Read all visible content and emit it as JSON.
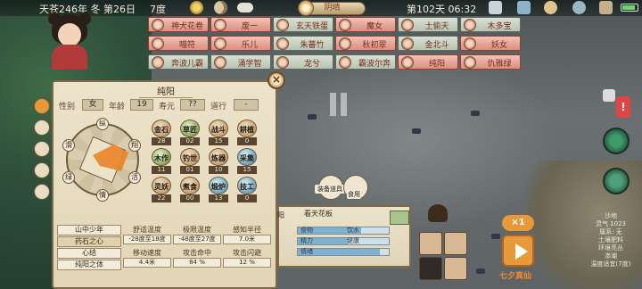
{
  "topbar": {
    "date": "天苍246年 冬 第26日",
    "temperature": "7度",
    "weather_badge": "阴晴",
    "day_time": "第102天 06:32"
  },
  "npcs": [
    {
      "name": "神犬花卷",
      "highlighted": true
    },
    {
      "name": "废一",
      "highlighted": true
    },
    {
      "name": "玄天铁蛋",
      "highlighted": false
    },
    {
      "name": "魔女",
      "highlighted": true
    },
    {
      "name": "土偷天",
      "highlighted": false
    },
    {
      "name": "木多宝",
      "highlighted": false
    },
    {
      "name": "喵符",
      "highlighted": true
    },
    {
      "name": "乐儿",
      "highlighted": true
    },
    {
      "name": "朱蕃竹",
      "highlighted": false
    },
    {
      "name": "秋初翠",
      "highlighted": true
    },
    {
      "name": "金北斗",
      "highlighted": false
    },
    {
      "name": "妖女",
      "highlighted": true
    },
    {
      "name": "奔波儿霸",
      "highlighted": false
    },
    {
      "name": "涌学智",
      "highlighted": false
    },
    {
      "name": "龙兮",
      "highlighted": false
    },
    {
      "name": "霸波尔奔",
      "highlighted": false
    },
    {
      "name": "纯阳",
      "highlighted": true
    },
    {
      "name": "仇雅绿",
      "highlighted": true
    }
  ],
  "character": {
    "name": "纯阳",
    "gender_label": "性别",
    "gender": "女",
    "age_label": "年龄",
    "age": "19",
    "lifespan_label": "寿元",
    "lifespan": "??",
    "dao_label": "道行",
    "dao": "-",
    "close_label": "×",
    "bagua_labels": [
      "纵",
      "翔",
      "活",
      "情",
      "绿",
      "滑"
    ],
    "skills": [
      {
        "name": "金石",
        "level": "28",
        "tone": "gold"
      },
      {
        "name": "草匠",
        "level": "02",
        "tone": "green"
      },
      {
        "name": "战斗",
        "level": "15",
        "tone": "gold"
      },
      {
        "name": "耕植",
        "level": "0",
        "tone": "gold"
      },
      {
        "name": "木作",
        "level": "11",
        "tone": "green"
      },
      {
        "name": "钓世",
        "level": "01",
        "tone": "gold"
      },
      {
        "name": "炼器",
        "level": "10",
        "tone": "gold"
      },
      {
        "name": "采集",
        "level": "15",
        "tone": "blue"
      },
      {
        "name": "灵妖",
        "level": "22",
        "tone": "gold"
      },
      {
        "name": "煮食",
        "level": "00",
        "tone": "gold"
      },
      {
        "name": "煅炉",
        "level": "13",
        "tone": "blue"
      },
      {
        "name": "技工",
        "level": "0",
        "tone": "blue"
      }
    ],
    "tags": [
      "山中少年",
      "药石之心",
      "心结",
      "纯阳之体"
    ],
    "stats": [
      {
        "label": "舒适温度",
        "value": "-28度至18度"
      },
      {
        "label": "极限温度",
        "value": "-48度至27度"
      },
      {
        "label": "感知半径",
        "value": "7.0米"
      },
      {
        "label": "移动速度",
        "value": "4.4米"
      },
      {
        "label": "攻击命中",
        "value": "84 %"
      },
      {
        "label": "攻击闪避",
        "value": "12 %"
      }
    ]
  },
  "item_panel": {
    "prefix": "阳",
    "title": "看天花板",
    "bars": [
      {
        "label": "食物",
        "label2": "饮水",
        "fill": 0.7
      },
      {
        "label": "精力",
        "label2": "健康",
        "fill": 0.55
      },
      {
        "label": "情绪",
        "label2": "",
        "fill": 0.9
      }
    ]
  },
  "actions": [
    {
      "label": "装备道具"
    },
    {
      "label": "食用"
    }
  ],
  "controls": {
    "speed": "×1",
    "auto_label": "七夕真仙"
  },
  "side_info": [
    "沙地",
    "灵气 1023",
    "属系: 无",
    "土壤肥料",
    "环境亮丛",
    "渗潮",
    "温度适宜(7度)"
  ],
  "alert": "!"
}
